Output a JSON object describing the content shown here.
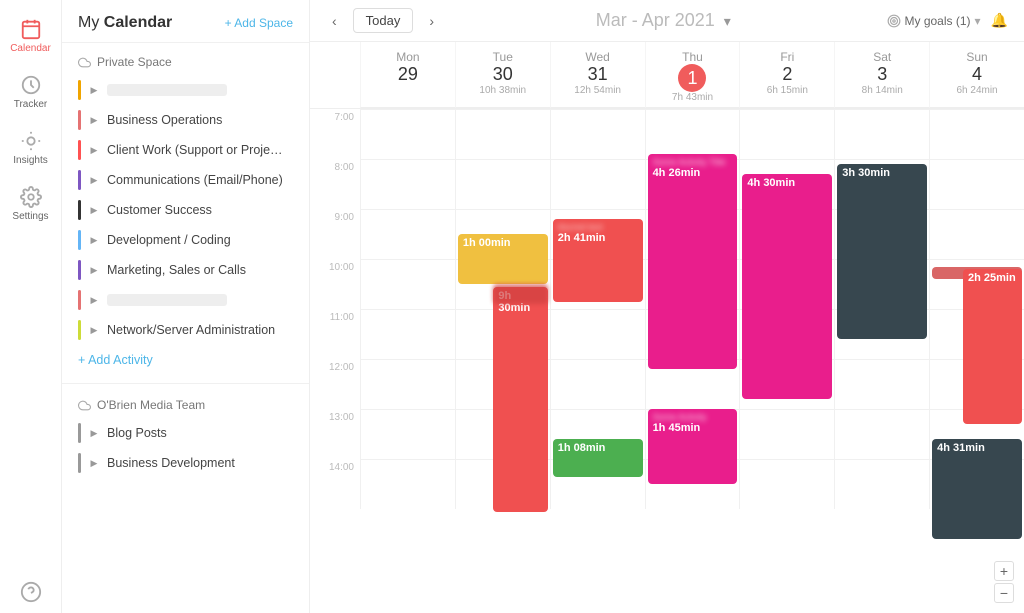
{
  "iconSidebar": {
    "items": [
      {
        "id": "calendar",
        "label": "Calendar",
        "active": true
      },
      {
        "id": "tracker",
        "label": "Tracker",
        "active": false
      },
      {
        "id": "insights",
        "label": "Insights",
        "active": false
      },
      {
        "id": "settings",
        "label": "Settings",
        "active": false
      }
    ],
    "bottomItems": [
      {
        "id": "help",
        "label": ""
      }
    ]
  },
  "spacePanel": {
    "title_my": "My ",
    "title_calendar": "Calendar",
    "addSpace": "+ Add Space",
    "privateSpace": "Private Space",
    "spaces": [
      {
        "id": "blurred1",
        "color": "#f0a500",
        "label": "",
        "blurred": true
      },
      {
        "id": "business-ops",
        "color": "#e57373",
        "label": "Business Operations"
      },
      {
        "id": "client-work",
        "color": "#ff5252",
        "label": "Client Work (Support or Proje…"
      },
      {
        "id": "communications",
        "color": "#7e57c2",
        "label": "Communications (Email/Phone)"
      },
      {
        "id": "customer-success",
        "color": "#333",
        "label": "Customer Success"
      },
      {
        "id": "development",
        "color": "#64b5f6",
        "label": "Development / Coding"
      },
      {
        "id": "marketing",
        "color": "#7e57c2",
        "label": "Marketing, Sales or Calls"
      },
      {
        "id": "blurred2",
        "color": "#e57373",
        "label": "",
        "blurred": true
      },
      {
        "id": "network",
        "color": "#cddc39",
        "label": "Network/Server Administration"
      }
    ],
    "addActivity": "+ Add Activity",
    "teamSection": {
      "teamName": "O'Brien Media Team",
      "items": [
        {
          "id": "blog-posts",
          "color": "#999",
          "label": "Blog Posts"
        },
        {
          "id": "business-dev",
          "color": "#999",
          "label": "Business Development"
        }
      ]
    }
  },
  "calendar": {
    "prevLabel": "‹",
    "todayLabel": "Today",
    "nextLabel": "›",
    "title": "Mar - Apr",
    "titleYear": " 2021",
    "goalsLabel": "My goals (1)",
    "days": [
      {
        "name": "Mon",
        "num": "29",
        "time": ""
      },
      {
        "name": "Tue",
        "num": "30",
        "time": "10h 38min"
      },
      {
        "name": "Wed",
        "num": "31",
        "time": "12h 54min"
      },
      {
        "name": "Thu",
        "num": "1",
        "time": "7h 43min",
        "today": true
      },
      {
        "name": "Fri",
        "num": "2",
        "time": "6h 15min"
      },
      {
        "name": "Sat",
        "num": "3",
        "time": "8h 14min"
      },
      {
        "name": "Sun",
        "num": "4",
        "time": "6h 24min"
      }
    ],
    "hours": [
      "7:00",
      "8:00",
      "9:00",
      "10:00",
      "11:00",
      "12:00",
      "13:00",
      "14:00"
    ],
    "events": [
      {
        "id": "tue-1",
        "day": 1,
        "color": "#f0c040",
        "startHour": 9.5,
        "endHour": 10.5,
        "duration": "1h 00min",
        "title": ""
      },
      {
        "id": "tue-2",
        "day": 1,
        "color": "#f05050",
        "startHour": 10.55,
        "endHour": 14.5,
        "duration": "9h 30min",
        "title": ""
      },
      {
        "id": "wed-1",
        "day": 2,
        "color": "#f05050",
        "startHour": 9.2,
        "endHour": 10.85,
        "duration": "2h 41min",
        "title": ""
      },
      {
        "id": "thu-1",
        "day": 3,
        "color": "#e91e8c",
        "startHour": 7.9,
        "endHour": 12.2,
        "duration": "4h 26min",
        "title": "Some Pink Activity"
      },
      {
        "id": "thu-2",
        "day": 3,
        "color": "#f05050",
        "startHour": 13.0,
        "endHour": 14.5,
        "duration": "1h 45min",
        "title": "Some Red Activity"
      },
      {
        "id": "fri-1",
        "day": 4,
        "color": "#e91e8c",
        "startHour": 8.3,
        "endHour": 12.8,
        "duration": "4h 30min",
        "title": ""
      },
      {
        "id": "sat-1",
        "day": 5,
        "color": "#37474f",
        "startHour": 8.1,
        "endHour": 11.6,
        "duration": "3h 30min",
        "title": ""
      },
      {
        "id": "sun-1",
        "day": 6,
        "color": "#f05050",
        "startHour": 10.2,
        "endHour": 13.3,
        "duration": "2h 25min",
        "title": ""
      },
      {
        "id": "sun-2",
        "day": 6,
        "color": "#f05050",
        "startHour": 10.15,
        "endHour": 10.6,
        "duration": "",
        "title": ""
      },
      {
        "id": "thu-3",
        "day": 3,
        "color": "#f05050",
        "startHour": 13.0,
        "endHour": 14.5,
        "duration": "1h 45min",
        "title": "Some Pink2"
      },
      {
        "id": "wed-blurred",
        "day": 2,
        "color": "#f05050",
        "startHour": 9.2,
        "endHour": 9.7,
        "duration": "",
        "title": "blurred"
      },
      {
        "id": "sun-3",
        "day": 6,
        "color": "#37474f",
        "startHour": 13.6,
        "endHour": 14.5,
        "duration": "4h 31min",
        "title": ""
      },
      {
        "id": "sun-top",
        "day": 6,
        "color": "#f05050",
        "startHour": 10.0,
        "endHour": 10.25,
        "duration": "",
        "title": ""
      },
      {
        "id": "thu-bottom",
        "day": 3,
        "color": "#e91e8c",
        "startHour": 13.0,
        "endHour": 13.9,
        "duration": "1h 45min",
        "title": "pink activity"
      },
      {
        "id": "wed-bottom",
        "day": 2,
        "color": "#4caf50",
        "startHour": 13.6,
        "endHour": 14.1,
        "duration": "1h 08min",
        "title": ""
      }
    ]
  }
}
